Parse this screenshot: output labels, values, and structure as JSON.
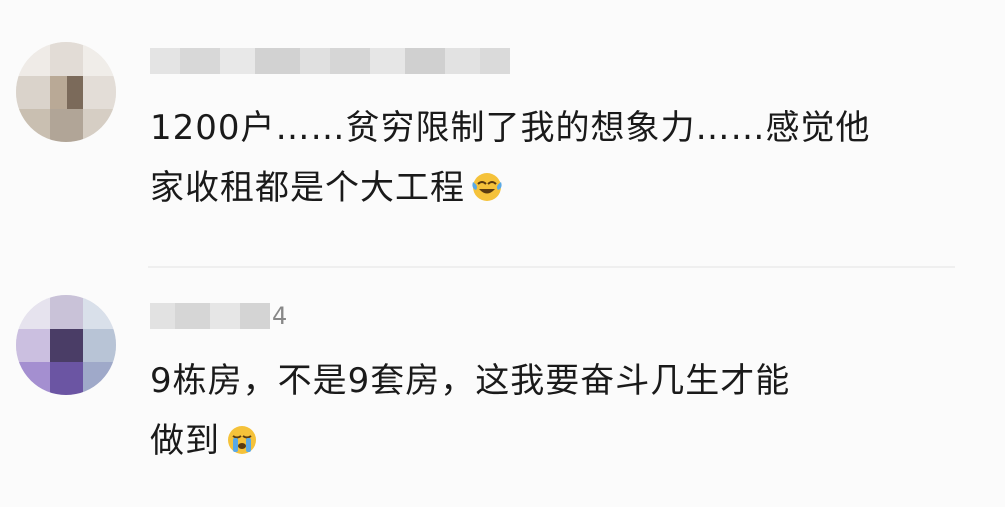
{
  "comments": [
    {
      "username_visible": "",
      "text_line1": "1200户……贫穷限制了我的想象力……感觉他",
      "text_line2": "家收租都是个大工程",
      "emoji": "laughing-crying-emoji"
    },
    {
      "username_visible": "4",
      "text_line1": "9栋房，不是9套房，这我要奋斗几生才能",
      "text_line2": "做到",
      "emoji": "crying-emoji"
    }
  ],
  "colors": {
    "background": "#fbfbfb",
    "text": "#1a1a1a",
    "divider": "#efefef",
    "emoji_yellow": "#f5c23a",
    "emoji_tear_blue": "#5aa9e6"
  }
}
